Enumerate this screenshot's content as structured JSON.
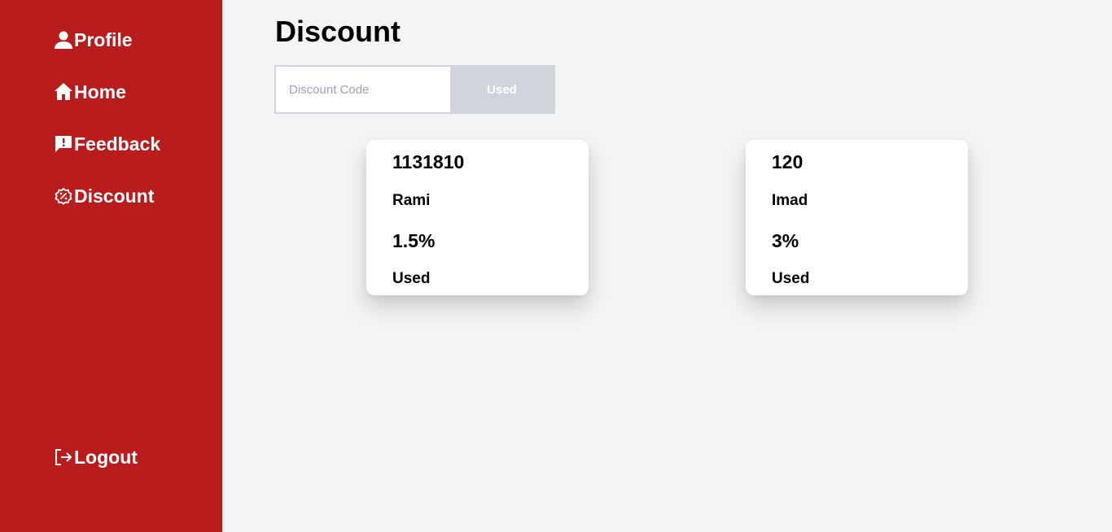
{
  "sidebar": {
    "items": [
      {
        "label": "Profile",
        "icon": "user-icon"
      },
      {
        "label": "Home",
        "icon": "home-icon"
      },
      {
        "label": "Feedback",
        "icon": "feedback-icon"
      },
      {
        "label": "Discount",
        "icon": "discount-badge-icon"
      }
    ],
    "logout": {
      "label": "Logout",
      "icon": "logout-icon"
    }
  },
  "main": {
    "title": "Discount",
    "filter": {
      "placeholder": "Discount Code",
      "value": "",
      "button_label": "Used"
    },
    "discounts": [
      {
        "code": "1131810",
        "owner": "Rami",
        "percent": "1.5%",
        "status": "Used"
      },
      {
        "code": "120",
        "owner": "Imad",
        "percent": "3%",
        "status": "Used"
      }
    ]
  },
  "colors": {
    "sidebar_bg": "#b91c1c",
    "page_bg": "#f3f4f6",
    "button_bg": "#d1d5db",
    "card_bg": "#ffffff"
  }
}
